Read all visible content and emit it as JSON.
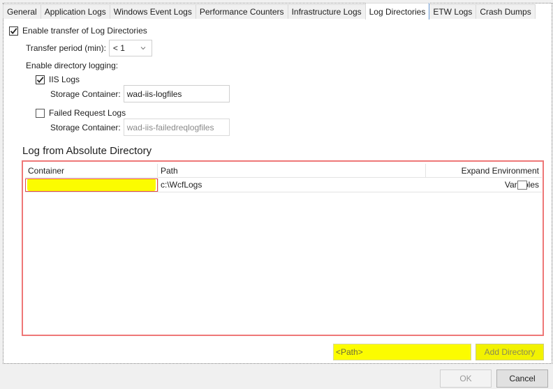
{
  "tabs": [
    {
      "label": "General",
      "active": false
    },
    {
      "label": "Application Logs",
      "active": false
    },
    {
      "label": "Windows Event Logs",
      "active": false
    },
    {
      "label": "Performance Counters",
      "active": false
    },
    {
      "label": "Infrastructure Logs",
      "active": false
    },
    {
      "label": "Log Directories",
      "active": true
    },
    {
      "label": "ETW Logs",
      "active": false
    },
    {
      "label": "Crash Dumps",
      "active": false
    }
  ],
  "log_directories": {
    "enable_transfer": {
      "label": "Enable transfer of Log Directories",
      "checked": true
    },
    "transfer_period": {
      "label": "Transfer period (min):",
      "value": "< 1",
      "icon": "chevron-down-icon"
    },
    "enable_directory_logging_label": "Enable directory logging:",
    "iis_logs": {
      "label": "IIS Logs",
      "checked": true,
      "storage_label": "Storage Container:",
      "storage_value": "wad-iis-logfiles"
    },
    "failed_request_logs": {
      "label": "Failed Request Logs",
      "checked": false,
      "storage_label": "Storage Container:",
      "storage_value": "wad-iis-failedreqlogfiles"
    },
    "absolute_directory": {
      "title": "Log from Absolute Directory",
      "columns": [
        "Container",
        "Path",
        "Expand Environment Variables"
      ],
      "rows": [
        {
          "container": "",
          "path": "c:\\WcfLogs",
          "expand_env": false
        }
      ]
    },
    "path_input": {
      "placeholder": "<Path>",
      "value": ""
    },
    "add_directory_label": "Add Directory"
  },
  "buttons": {
    "ok": "OK",
    "cancel": "Cancel"
  },
  "colors": {
    "highlight": "#fcfc00",
    "error_border": "#ee7777"
  }
}
